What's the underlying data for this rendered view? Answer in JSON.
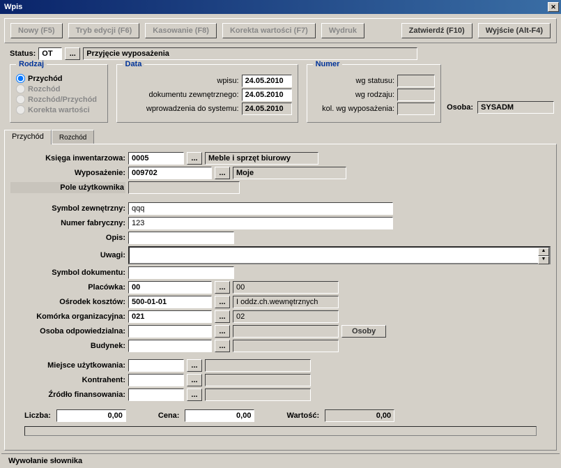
{
  "window": {
    "title": "Wpis"
  },
  "toolbar": {
    "nowy": "Nowy (F5)",
    "tryb": "Tryb edycji (F6)",
    "kasowanie": "Kasowanie (F8)",
    "korekta": "Korekta wartości (F7)",
    "wydruk": "Wydruk",
    "zatwierdz": "Zatwierdź (F10)",
    "wyjscie": "Wyjście (Alt-F4)"
  },
  "status": {
    "label": "Status:",
    "code": "OT",
    "desc": "Przyjęcie wyposażenia"
  },
  "rodzaj": {
    "title": "Rodzaj",
    "o1": "Przychód",
    "o2": "Rozchód",
    "o3": "Rozchód/Przychód",
    "o4": "Korekta wartości"
  },
  "data": {
    "title": "Data",
    "l1": "wpisu:",
    "l2": "dokumentu zewnętrznego:",
    "l3": "wprowadzenia do systemu:",
    "v1": "24.05.2010",
    "v2": "24.05.2010",
    "v3": "24.05.2010"
  },
  "numer": {
    "title": "Numer",
    "l1": "wg statusu:",
    "l2": "wg rodzaju:",
    "l3": "kol. wg wyposażenia:",
    "v1": "",
    "v2": "",
    "v3": ""
  },
  "osoba": {
    "label": "Osoba:",
    "value": "SYSADM"
  },
  "tabs": {
    "t1": "Przychód",
    "t2": "Rozchód"
  },
  "form": {
    "ksiega": {
      "l": "Księga inwentarzowa:",
      "code": "0005",
      "name": "Meble i sprzęt biurowy"
    },
    "wypos": {
      "l": "Wyposażenie:",
      "code": "009702",
      "name": "Moje"
    },
    "pole": {
      "l": "Pole użytkownika",
      "v": ""
    },
    "symz": {
      "l": "Symbol zewnętrzny:",
      "v": "qqq"
    },
    "numf": {
      "l": "Numer fabryczny:",
      "v": "123"
    },
    "opis": {
      "l": "Opis:",
      "v": ""
    },
    "uwagi": {
      "l": "Uwagi:",
      "v": ""
    },
    "symd": {
      "l": "Symbol dokumentu:",
      "v": ""
    },
    "plac": {
      "l": "Placówka:",
      "code": "00",
      "name": "00"
    },
    "osrk": {
      "l": "Ośrodek kosztów:",
      "code": "500-01-01",
      "name": "I oddz.ch.wewnętrznych"
    },
    "kom": {
      "l": "Komórka organizacyjna:",
      "code": "021",
      "name": "02"
    },
    "osob": {
      "l": "Osoba odpowiedzialna:",
      "code": "",
      "name": "",
      "btn": "Osoby"
    },
    "bud": {
      "l": "Budynek:",
      "code": "",
      "name": ""
    },
    "miej": {
      "l": "Miejsce użytkowania:",
      "code": "",
      "name": ""
    },
    "kont": {
      "l": "Kontrahent:",
      "code": "",
      "name": ""
    },
    "zrod": {
      "l": "Źródło finansowania:",
      "code": "",
      "name": ""
    }
  },
  "footer": {
    "l1": "Liczba:",
    "v1": "0,00",
    "l2": "Cena:",
    "v2": "0,00",
    "l3": "Wartość:",
    "v3": "0,00"
  },
  "statusbar": "Wywołanie słownika"
}
